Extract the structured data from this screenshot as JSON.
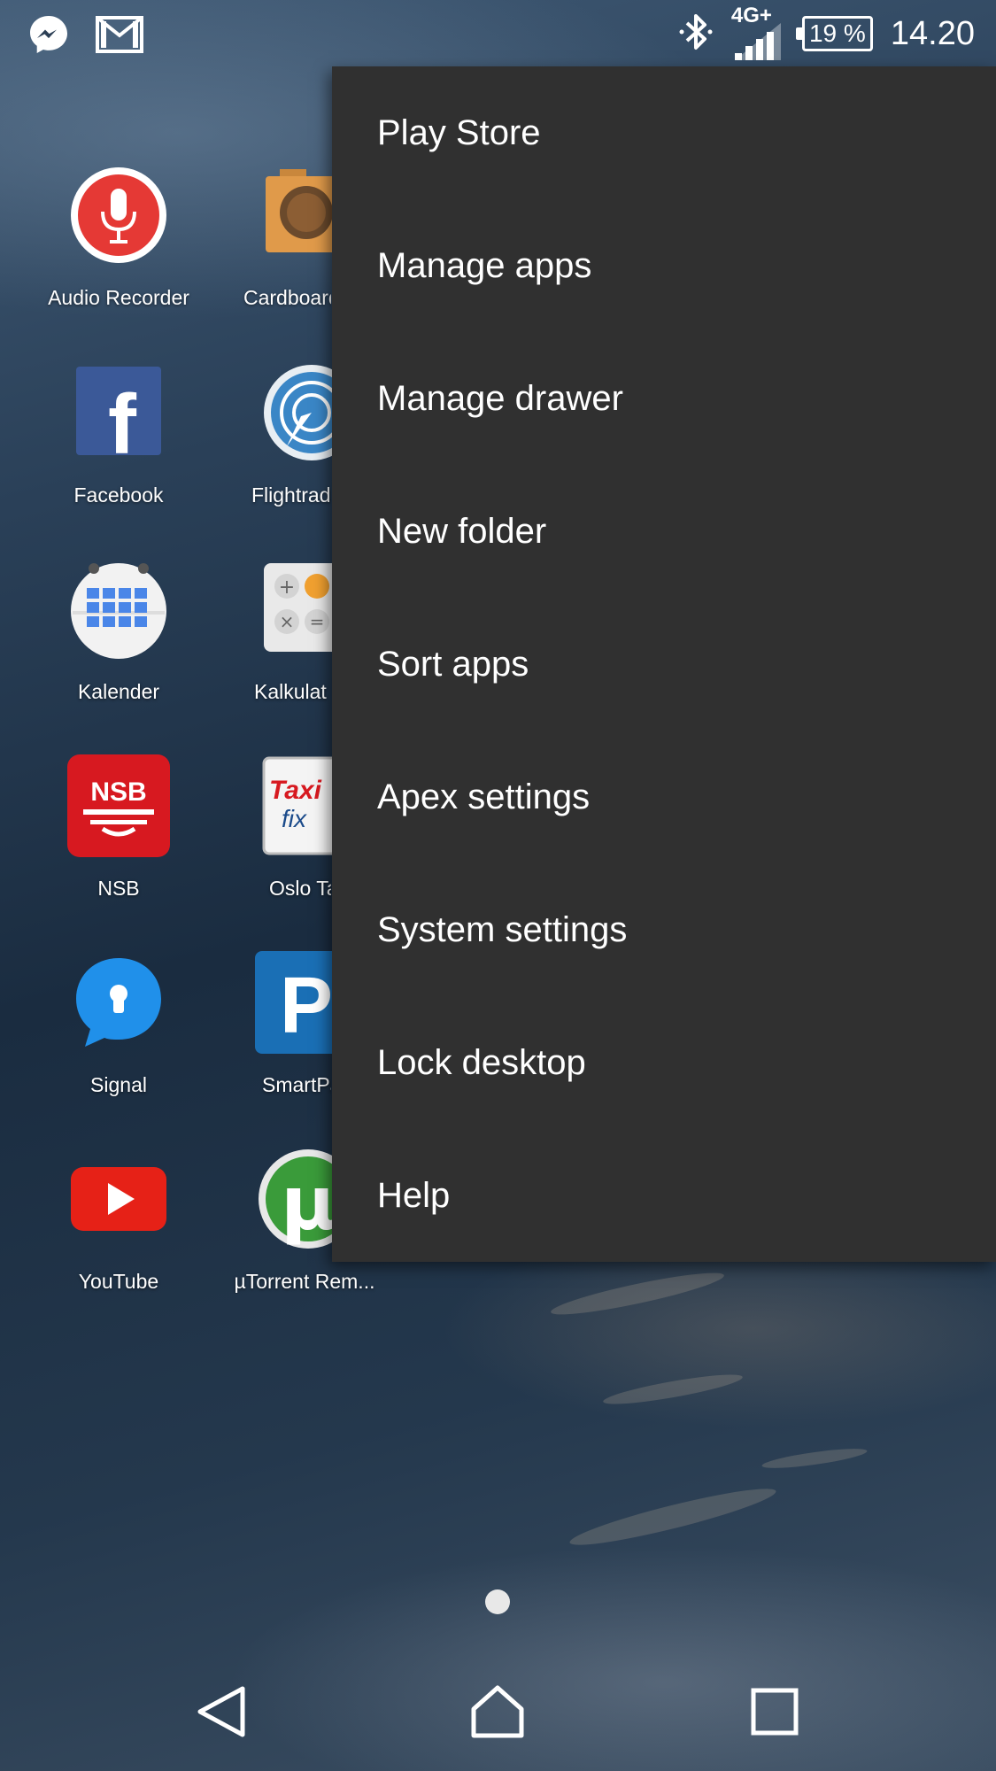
{
  "status_bar": {
    "network": "4G+",
    "battery": "19 %",
    "time": "14.20",
    "icons": [
      "messenger-icon",
      "gmail-icon",
      "bluetooth-icon",
      "signal-strength-icon",
      "battery-icon"
    ]
  },
  "apps": [
    {
      "label": "Audio Recorder",
      "icon": "audio-recorder-icon"
    },
    {
      "label": "Cardboard",
      "icon": "cardboard-icon"
    },
    {
      "label": "Facebook",
      "icon": "facebook-icon"
    },
    {
      "label": "Flightrada",
      "icon": "flightradar-icon"
    },
    {
      "label": "Kalender",
      "icon": "calendar-icon"
    },
    {
      "label": "Kalkulat",
      "icon": "calculator-icon"
    },
    {
      "label": "NSB",
      "icon": "nsb-icon"
    },
    {
      "label": "Oslo Ta",
      "icon": "taxi-fix-icon"
    },
    {
      "label": "Signal",
      "icon": "signal-icon"
    },
    {
      "label": "SmartPa",
      "icon": "smartpark-icon"
    },
    {
      "label": "YouTube",
      "icon": "youtube-icon"
    },
    {
      "label": "µTorrent Rem...",
      "icon": "utorrent-icon"
    }
  ],
  "icon_text": {
    "facebook": "f",
    "nsb": "NSB",
    "taxi": "Taxi",
    "taxi_fix": "fix",
    "smartpark": "P",
    "utorrent": "µ",
    "calc_plus": "+",
    "calc_times": "×",
    "calc_eq": "="
  },
  "menu": {
    "items": [
      "Play Store",
      "Manage apps",
      "Manage drawer",
      "New folder",
      "Sort apps",
      "Apex settings",
      "System settings",
      "Lock desktop",
      "Help"
    ]
  },
  "nav": {
    "icons": [
      "back-icon",
      "home-icon",
      "recents-icon"
    ]
  },
  "colors": {
    "menu_bg": "#303030",
    "audio_recorder": "#e53935",
    "facebook": "#3b5998",
    "nsb": "#d71920",
    "signal": "#2090ea",
    "youtube": "#e62117",
    "smartpark": "#1a6fb5",
    "utorrent": "#3a9b3a"
  }
}
